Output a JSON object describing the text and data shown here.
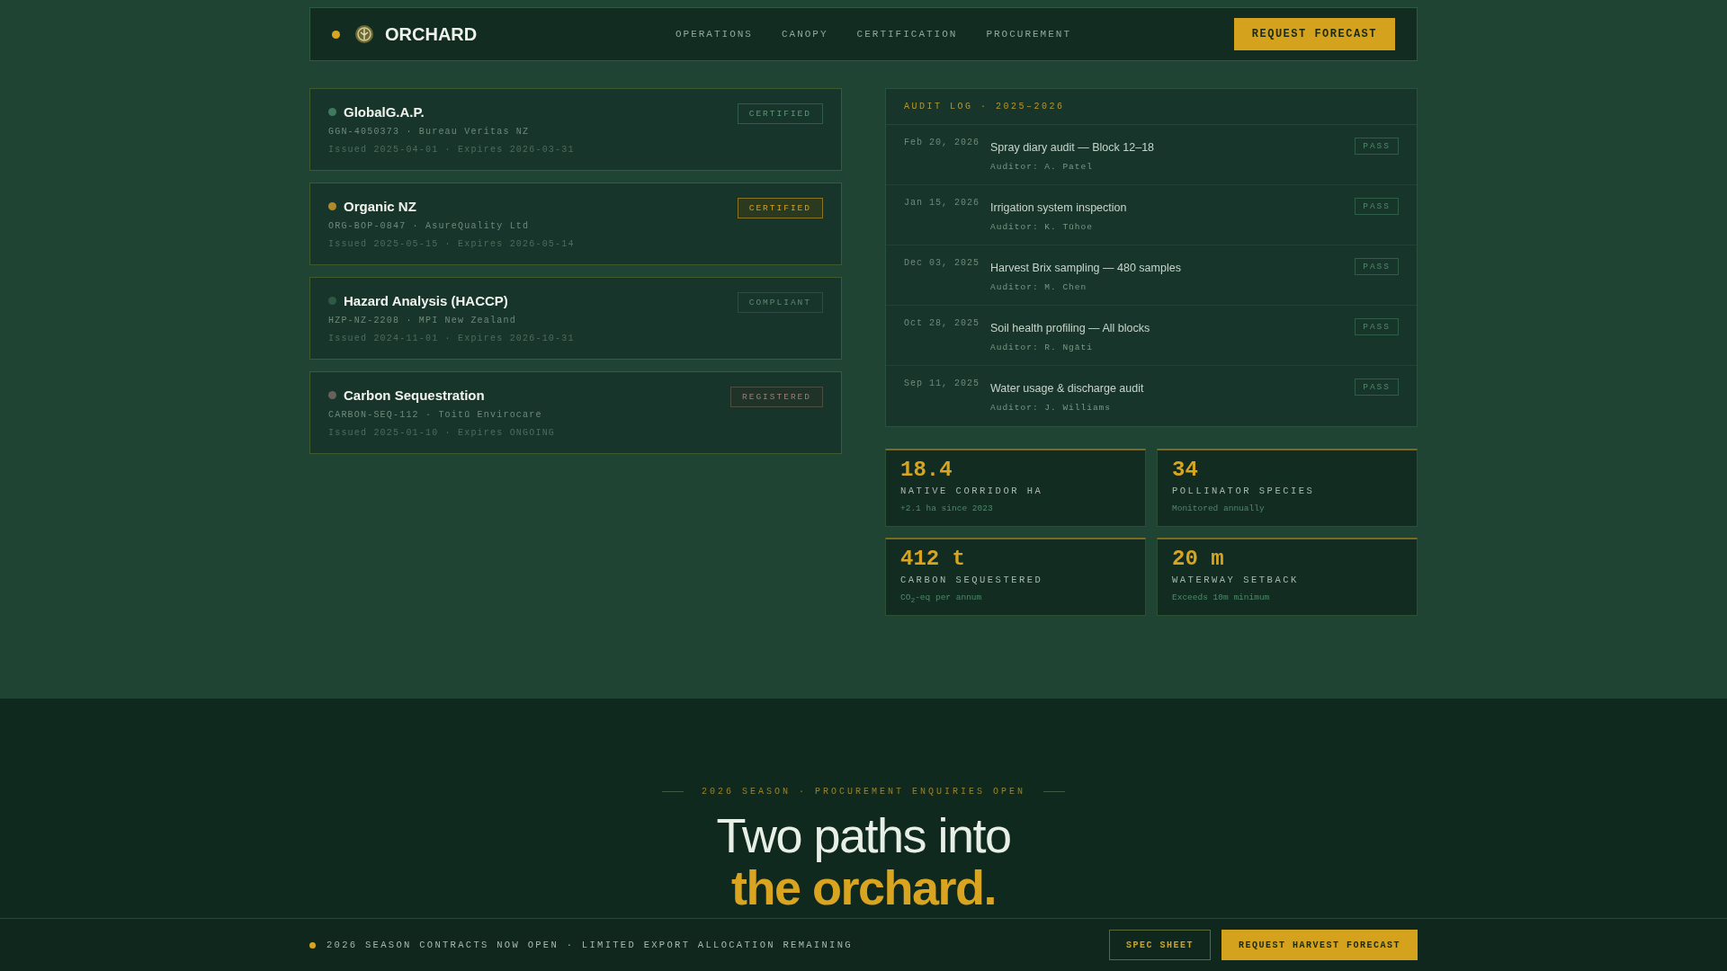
{
  "header": {
    "brand": "ORCHARD",
    "nav": [
      {
        "label": "OPERATIONS"
      },
      {
        "label": "CANOPY"
      },
      {
        "label": "CERTIFICATION"
      },
      {
        "label": "PROCUREMENT"
      }
    ],
    "cta": "REQUEST FORECAST"
  },
  "certifications": [
    {
      "name": "GlobalG.A.P.",
      "color": "#3f7a5c",
      "id_line": "GGN-4050373 · Bureau Veritas NZ",
      "dates": "Issued 2025-04-01 · Expires 2026-03-31",
      "badge": {
        "label": "CERTIFIED",
        "kind": "verified"
      }
    },
    {
      "name": "Organic NZ",
      "color": "#b08a2a",
      "id_line": "ORG-BOP-0847 · AsureQuality Ltd",
      "dates": "Issued 2025-05-15 · Expires 2026-05-14",
      "badge": {
        "label": "CERTIFIED",
        "kind": "premium"
      }
    },
    {
      "name": "Hazard Analysis (HACCP)",
      "color": "#2c5a44",
      "id_line": "HZP-NZ-2208 · MPI New Zealand",
      "dates": "Issued 2024-11-01 · Expires 2026-10-31",
      "badge": {
        "label": "COMPLIANT",
        "kind": "inactive"
      }
    },
    {
      "name": "Carbon Sequestration",
      "color": "#6a605a",
      "id_line": "CARBON-SEQ-112 · Toitū Envirocare",
      "dates": "Issued 2025-01-10 · Expires ONGOING",
      "badge": {
        "label": "REGISTERED",
        "kind": "pending"
      }
    }
  ],
  "audit_log": {
    "title": "AUDIT LOG · 2025–2026",
    "entries": [
      {
        "date": "Feb 20, 2026",
        "title": "Spray diary audit — Block 12–18",
        "auditor": "Auditor: A. Patel",
        "result": "PASS"
      },
      {
        "date": "Jan 15, 2026",
        "title": "Irrigation system inspection",
        "auditor": "Auditor: K. Tūhoe",
        "result": "PASS"
      },
      {
        "date": "Dec 03, 2025",
        "title": "Harvest Brix sampling — 480 samples",
        "auditor": "Auditor: M. Chen",
        "result": "PASS"
      },
      {
        "date": "Oct 28, 2025",
        "title": "Soil health profiling — All blocks",
        "auditor": "Auditor: R. Ngāti",
        "result": "PASS"
      },
      {
        "date": "Sep 11, 2025",
        "title": "Water usage & discharge audit",
        "auditor": "Auditor: J. Williams",
        "result": "PASS"
      }
    ]
  },
  "stats": [
    {
      "value": "18.4",
      "label": "NATIVE CORRIDOR HA",
      "note": "+2.1 ha since 2023"
    },
    {
      "value": "34",
      "label": "POLLINATOR SPECIES",
      "note": "Monitored annually"
    },
    {
      "value": "412 t",
      "label": "CARBON SEQUESTERED",
      "note": "CO$_{2}$-eq per annum"
    },
    {
      "value": "20 m",
      "label": "WATERWAY SETBACK",
      "note": "Exceeds 10m minimum"
    }
  ],
  "cta_section": {
    "eyebrow": "2026 SEASON · PROCUREMENT ENQUIRIES OPEN",
    "heading_line_1": "Two paths into",
    "heading_line_2": "the orchard."
  },
  "bottom_bar": {
    "message": "2026 SEASON CONTRACTS NOW OPEN · LIMITED EXPORT ALLOCATION REMAINING",
    "buttons": [
      {
        "label": "SPEC SHEET",
        "kind": "outline"
      },
      {
        "label": "REQUEST HARVEST FORECAST",
        "kind": "solid"
      }
    ]
  }
}
